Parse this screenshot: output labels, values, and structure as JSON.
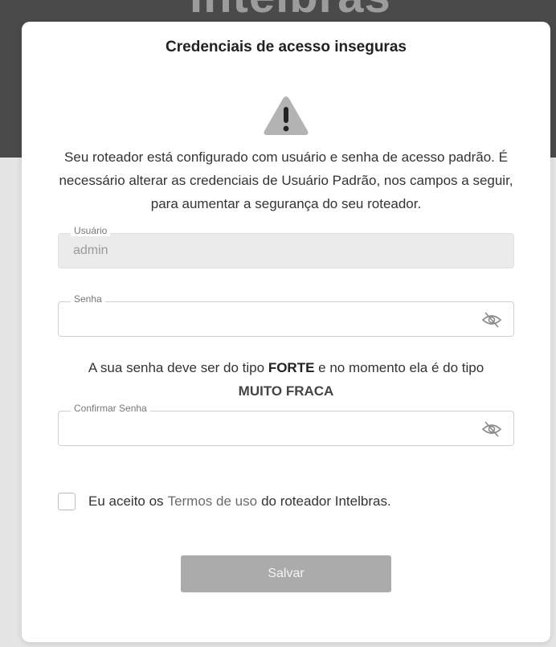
{
  "brand": {
    "name": "Intelbras"
  },
  "modal": {
    "title": "Credenciais de acesso inseguras",
    "warning_icon": "warning-triangle-icon",
    "description": "Seu roteador está configurado com usuário e senha de acesso padrão. É necessário alterar as credenciais de Usuário Padrão, nos campos a seguir, para aumentar a segurança do seu roteador."
  },
  "form": {
    "username": {
      "label": "Usuário",
      "value": "admin"
    },
    "password": {
      "label": "Senha",
      "value": "",
      "toggle_icon": "eye-slash-icon"
    },
    "strength": {
      "prefix": "A sua senha deve ser do tipo",
      "required": "FORTE",
      "middle": "e no momento ela é do tipo",
      "current": "MUITO FRACA"
    },
    "confirm_password": {
      "label": "Confirmar Senha",
      "value": "",
      "toggle_icon": "eye-slash-icon"
    },
    "terms": {
      "before": "Eu aceito os",
      "link": "Termos de uso",
      "after": "do roteador Intelbras.",
      "checked": false
    },
    "save_label": "Salvar"
  },
  "colors": {
    "header_bg": "#4a4a4a",
    "button_disabled": "#ababab",
    "link": "#6b6b6b"
  }
}
